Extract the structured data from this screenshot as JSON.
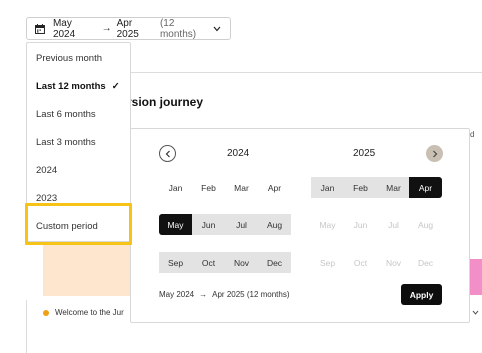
{
  "trigger": {
    "start": "May 2024",
    "arrow": "→",
    "end": "Apr 2025",
    "duration": "(12 months)"
  },
  "background": {
    "title": "rsion journey",
    "right_edge_text": "d",
    "legend_label": "Welcome to the Jur",
    "colors": {
      "peach": "#fde6cd",
      "pink": "#f28fc9",
      "legend_dot": "#f0a013"
    }
  },
  "presets": [
    {
      "label": "Previous month",
      "active": false
    },
    {
      "label": "Last 12 months",
      "active": true,
      "check": "✓"
    },
    {
      "label": "Last 6 months",
      "active": false
    },
    {
      "label": "Last 3 months",
      "active": false
    },
    {
      "label": "2024",
      "active": false
    },
    {
      "label": "2023",
      "active": false
    },
    {
      "label": "Custom period",
      "active": false,
      "highlighted": true
    }
  ],
  "calendar": {
    "left_year": "2024",
    "right_year": "2025",
    "left_months": [
      "Jan",
      "Feb",
      "Mar",
      "Apr",
      "May",
      "Jun",
      "Jul",
      "Aug",
      "Sep",
      "Oct",
      "Nov",
      "Dec"
    ],
    "right_months": [
      "Jan",
      "Feb",
      "Mar",
      "Apr",
      "May",
      "Jun",
      "Jul",
      "Aug",
      "Sep",
      "Oct",
      "Nov",
      "Dec"
    ],
    "range_start": "May 2024",
    "range_arrow": "→",
    "range_end": "Apr 2025 (12 months)",
    "apply_label": "Apply",
    "colors": {
      "selected": "#111111",
      "in_range": "#e3e3e3",
      "highlight": "#f5c417"
    }
  }
}
